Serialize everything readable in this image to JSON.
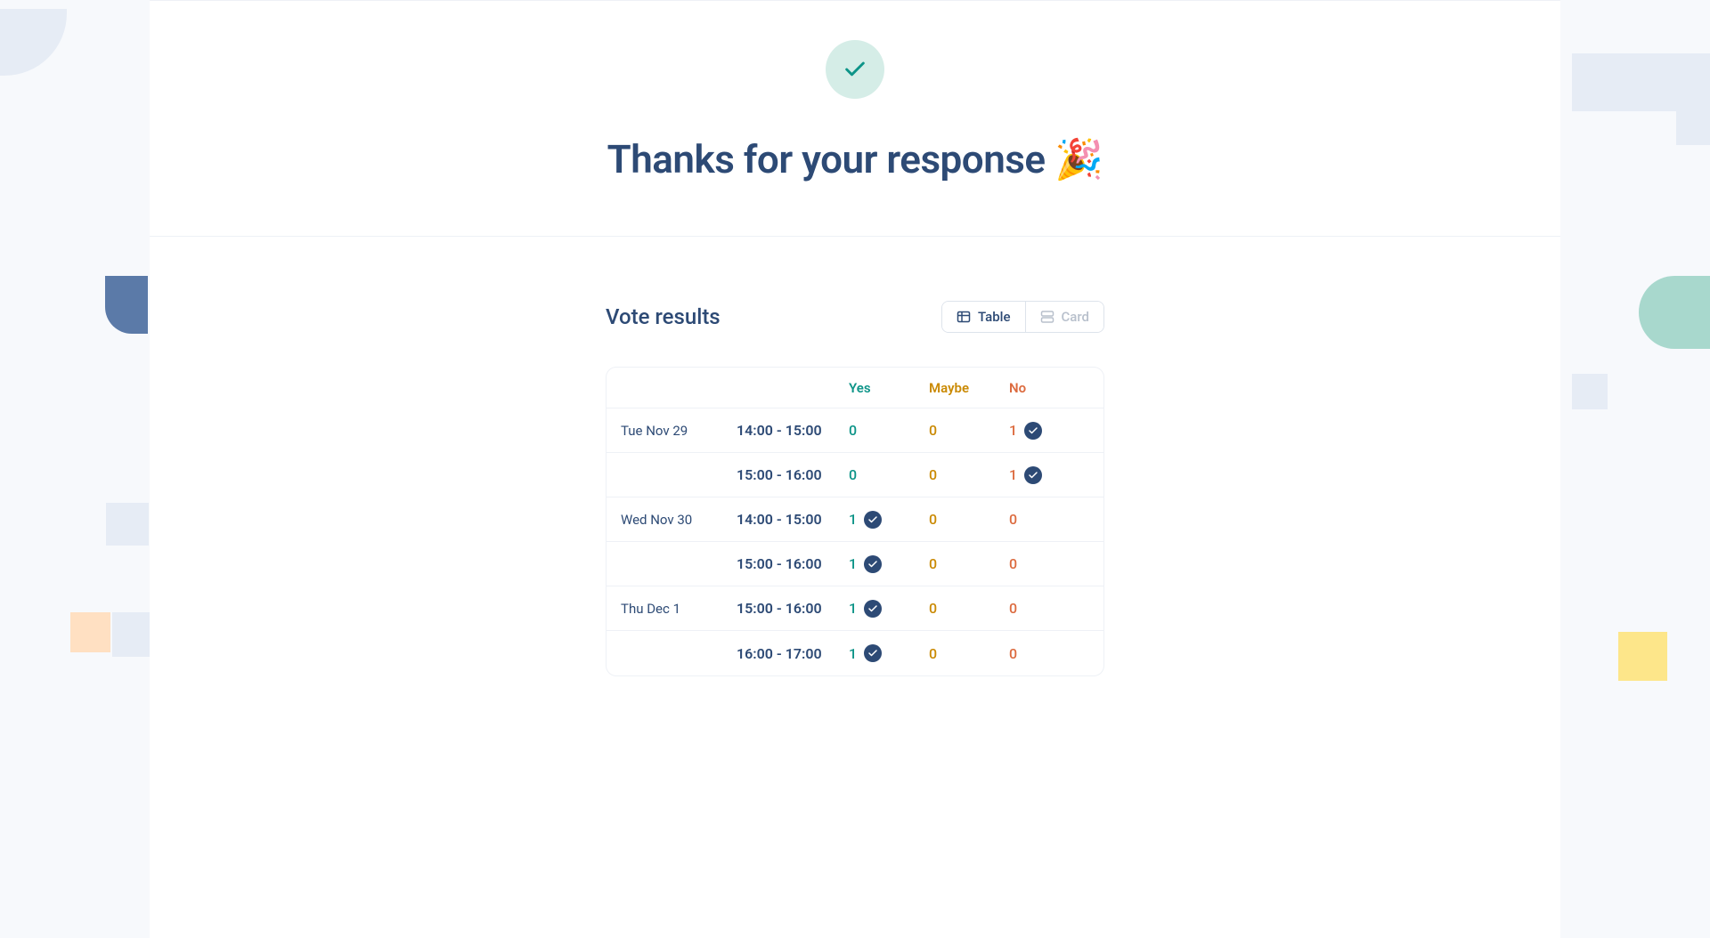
{
  "header": {
    "title": "Thanks for your response 🎉"
  },
  "results": {
    "title": "Vote results",
    "view_toggle": {
      "table_label": "Table",
      "card_label": "Card"
    },
    "columns": {
      "yes": "Yes",
      "maybe": "Maybe",
      "no": "No"
    },
    "rows": [
      {
        "date": "Tue Nov 29",
        "time": "14:00 - 15:00",
        "yes": 0,
        "maybe": 0,
        "no": 1,
        "voted": "no"
      },
      {
        "date": "",
        "time": "15:00 - 16:00",
        "yes": 0,
        "maybe": 0,
        "no": 1,
        "voted": "no"
      },
      {
        "date": "Wed Nov 30",
        "time": "14:00 - 15:00",
        "yes": 1,
        "maybe": 0,
        "no": 0,
        "voted": "yes"
      },
      {
        "date": "",
        "time": "15:00 - 16:00",
        "yes": 1,
        "maybe": 0,
        "no": 0,
        "voted": "yes"
      },
      {
        "date": "Thu Dec 1",
        "time": "15:00 - 16:00",
        "yes": 1,
        "maybe": 0,
        "no": 0,
        "voted": "yes"
      },
      {
        "date": "",
        "time": "16:00 - 17:00",
        "yes": 1,
        "maybe": 0,
        "no": 0,
        "voted": "yes"
      }
    ]
  }
}
